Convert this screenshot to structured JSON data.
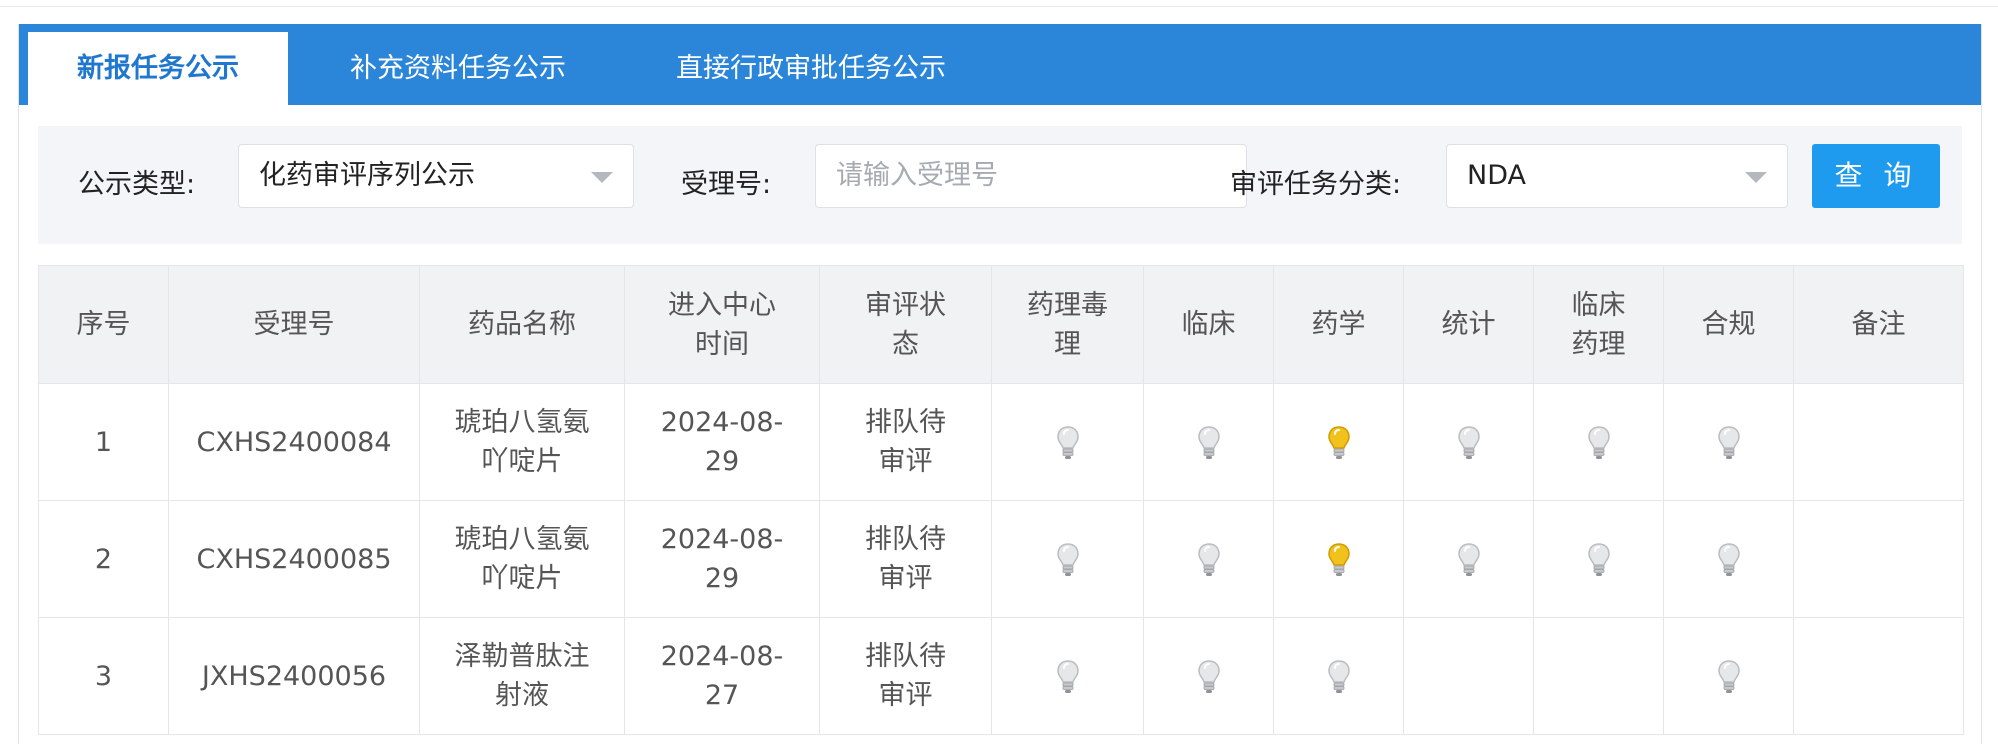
{
  "tabs": [
    {
      "label": "新报任务公示",
      "active": true
    },
    {
      "label": "补充资料任务公示",
      "active": false
    },
    {
      "label": "直接行政审批任务公示",
      "active": false
    }
  ],
  "filters": {
    "type_label": "公示类型:",
    "type_value": "化药审评序列公示",
    "accept_label": "受理号:",
    "accept_placeholder": "请输入受理号",
    "task_label": "审评任务分类:",
    "task_value": "NDA",
    "search_button": "查 询"
  },
  "table": {
    "headers": [
      "序号",
      "受理号",
      "药品名称",
      "进入中心时间",
      "审评状态",
      "药理毒理",
      "临床",
      "药学",
      "统计",
      "临床药理",
      "合规",
      "备注"
    ],
    "header_lines": [
      [
        "序号"
      ],
      [
        "受理号"
      ],
      [
        "药品名称"
      ],
      [
        "进入中心",
        "时间"
      ],
      [
        "审评状",
        "态"
      ],
      [
        "药理毒",
        "理"
      ],
      [
        "临床"
      ],
      [
        "药学"
      ],
      [
        "统计"
      ],
      [
        "临床",
        "药理"
      ],
      [
        "合规"
      ],
      [
        "备注"
      ]
    ],
    "rows": [
      {
        "no": "1",
        "accept_no": "CXHS2400084",
        "drug_name": "琥珀八氢氨吖啶片",
        "drug_lines": [
          "琥珀八氢氨",
          "吖啶片"
        ],
        "date": "2024-08-29",
        "date_lines": [
          "2024-08-",
          "29"
        ],
        "status": "排队待审评",
        "status_lines": [
          "排队待",
          "审评"
        ],
        "indicators": [
          "off",
          "off",
          "on",
          "off",
          "off",
          "off"
        ],
        "note": ""
      },
      {
        "no": "2",
        "accept_no": "CXHS2400085",
        "drug_name": "琥珀八氢氨吖啶片",
        "drug_lines": [
          "琥珀八氢氨",
          "吖啶片"
        ],
        "date": "2024-08-29",
        "date_lines": [
          "2024-08-",
          "29"
        ],
        "status": "排队待审评",
        "status_lines": [
          "排队待",
          "审评"
        ],
        "indicators": [
          "off",
          "off",
          "on",
          "off",
          "off",
          "off"
        ],
        "note": ""
      },
      {
        "no": "3",
        "accept_no": "JXHS2400056",
        "drug_name": "泽勒普肽注射液",
        "drug_lines": [
          "泽勒普肽注",
          "射液"
        ],
        "date": "2024-08-27",
        "date_lines": [
          "2024-08-",
          "27"
        ],
        "status": "排队待审评",
        "status_lines": [
          "排队待",
          "审评"
        ],
        "indicators": [
          "off",
          "off",
          "off",
          "none",
          "none",
          "off"
        ],
        "note": ""
      }
    ]
  },
  "colors": {
    "tabbar": "#2b86d9",
    "button": "#1e9bef",
    "bulb_on": "#f1c21b",
    "bulb_off": "#e6e7e9"
  },
  "icons": {
    "indicator": "lightbulb-icon"
  }
}
